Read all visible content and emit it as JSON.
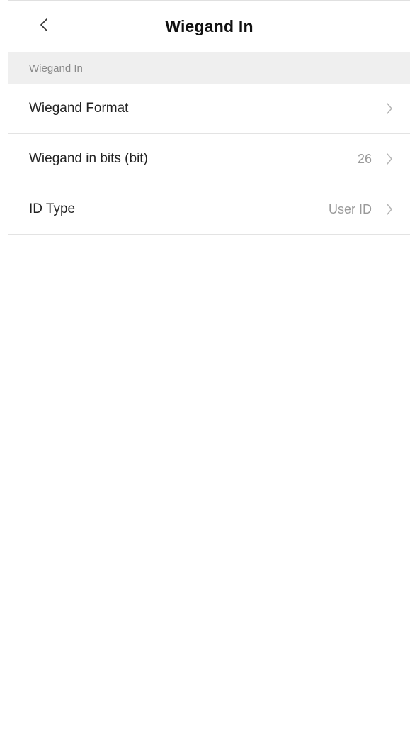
{
  "header": {
    "title": "Wiegand In",
    "back_icon": "chevron-left-icon"
  },
  "section": {
    "title": "Wiegand In"
  },
  "settings": {
    "items": [
      {
        "label": "Wiegand Format",
        "value": ""
      },
      {
        "label": "Wiegand in bits (bit)",
        "value": "26"
      },
      {
        "label": "ID Type",
        "value": "User ID"
      }
    ]
  },
  "colors": {
    "section_background": "#efefef",
    "divider": "#e3e3e3",
    "secondary_text": "#9a9a9a",
    "chevron": "#b5b5b5"
  }
}
